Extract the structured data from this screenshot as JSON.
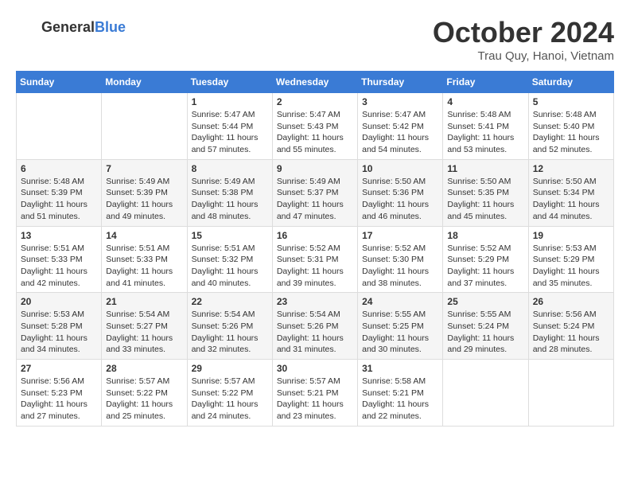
{
  "header": {
    "logo_general": "General",
    "logo_blue": "Blue",
    "month": "October 2024",
    "location": "Trau Quy, Hanoi, Vietnam"
  },
  "weekdays": [
    "Sunday",
    "Monday",
    "Tuesday",
    "Wednesday",
    "Thursday",
    "Friday",
    "Saturday"
  ],
  "weeks": [
    [
      {
        "day": "",
        "info": ""
      },
      {
        "day": "",
        "info": ""
      },
      {
        "day": "1",
        "info": "Sunrise: 5:47 AM\nSunset: 5:44 PM\nDaylight: 11 hours\nand 57 minutes."
      },
      {
        "day": "2",
        "info": "Sunrise: 5:47 AM\nSunset: 5:43 PM\nDaylight: 11 hours\nand 55 minutes."
      },
      {
        "day": "3",
        "info": "Sunrise: 5:47 AM\nSunset: 5:42 PM\nDaylight: 11 hours\nand 54 minutes."
      },
      {
        "day": "4",
        "info": "Sunrise: 5:48 AM\nSunset: 5:41 PM\nDaylight: 11 hours\nand 53 minutes."
      },
      {
        "day": "5",
        "info": "Sunrise: 5:48 AM\nSunset: 5:40 PM\nDaylight: 11 hours\nand 52 minutes."
      }
    ],
    [
      {
        "day": "6",
        "info": "Sunrise: 5:48 AM\nSunset: 5:39 PM\nDaylight: 11 hours\nand 51 minutes."
      },
      {
        "day": "7",
        "info": "Sunrise: 5:49 AM\nSunset: 5:39 PM\nDaylight: 11 hours\nand 49 minutes."
      },
      {
        "day": "8",
        "info": "Sunrise: 5:49 AM\nSunset: 5:38 PM\nDaylight: 11 hours\nand 48 minutes."
      },
      {
        "day": "9",
        "info": "Sunrise: 5:49 AM\nSunset: 5:37 PM\nDaylight: 11 hours\nand 47 minutes."
      },
      {
        "day": "10",
        "info": "Sunrise: 5:50 AM\nSunset: 5:36 PM\nDaylight: 11 hours\nand 46 minutes."
      },
      {
        "day": "11",
        "info": "Sunrise: 5:50 AM\nSunset: 5:35 PM\nDaylight: 11 hours\nand 45 minutes."
      },
      {
        "day": "12",
        "info": "Sunrise: 5:50 AM\nSunset: 5:34 PM\nDaylight: 11 hours\nand 44 minutes."
      }
    ],
    [
      {
        "day": "13",
        "info": "Sunrise: 5:51 AM\nSunset: 5:33 PM\nDaylight: 11 hours\nand 42 minutes."
      },
      {
        "day": "14",
        "info": "Sunrise: 5:51 AM\nSunset: 5:33 PM\nDaylight: 11 hours\nand 41 minutes."
      },
      {
        "day": "15",
        "info": "Sunrise: 5:51 AM\nSunset: 5:32 PM\nDaylight: 11 hours\nand 40 minutes."
      },
      {
        "day": "16",
        "info": "Sunrise: 5:52 AM\nSunset: 5:31 PM\nDaylight: 11 hours\nand 39 minutes."
      },
      {
        "day": "17",
        "info": "Sunrise: 5:52 AM\nSunset: 5:30 PM\nDaylight: 11 hours\nand 38 minutes."
      },
      {
        "day": "18",
        "info": "Sunrise: 5:52 AM\nSunset: 5:29 PM\nDaylight: 11 hours\nand 37 minutes."
      },
      {
        "day": "19",
        "info": "Sunrise: 5:53 AM\nSunset: 5:29 PM\nDaylight: 11 hours\nand 35 minutes."
      }
    ],
    [
      {
        "day": "20",
        "info": "Sunrise: 5:53 AM\nSunset: 5:28 PM\nDaylight: 11 hours\nand 34 minutes."
      },
      {
        "day": "21",
        "info": "Sunrise: 5:54 AM\nSunset: 5:27 PM\nDaylight: 11 hours\nand 33 minutes."
      },
      {
        "day": "22",
        "info": "Sunrise: 5:54 AM\nSunset: 5:26 PM\nDaylight: 11 hours\nand 32 minutes."
      },
      {
        "day": "23",
        "info": "Sunrise: 5:54 AM\nSunset: 5:26 PM\nDaylight: 11 hours\nand 31 minutes."
      },
      {
        "day": "24",
        "info": "Sunrise: 5:55 AM\nSunset: 5:25 PM\nDaylight: 11 hours\nand 30 minutes."
      },
      {
        "day": "25",
        "info": "Sunrise: 5:55 AM\nSunset: 5:24 PM\nDaylight: 11 hours\nand 29 minutes."
      },
      {
        "day": "26",
        "info": "Sunrise: 5:56 AM\nSunset: 5:24 PM\nDaylight: 11 hours\nand 28 minutes."
      }
    ],
    [
      {
        "day": "27",
        "info": "Sunrise: 5:56 AM\nSunset: 5:23 PM\nDaylight: 11 hours\nand 27 minutes."
      },
      {
        "day": "28",
        "info": "Sunrise: 5:57 AM\nSunset: 5:22 PM\nDaylight: 11 hours\nand 25 minutes."
      },
      {
        "day": "29",
        "info": "Sunrise: 5:57 AM\nSunset: 5:22 PM\nDaylight: 11 hours\nand 24 minutes."
      },
      {
        "day": "30",
        "info": "Sunrise: 5:57 AM\nSunset: 5:21 PM\nDaylight: 11 hours\nand 23 minutes."
      },
      {
        "day": "31",
        "info": "Sunrise: 5:58 AM\nSunset: 5:21 PM\nDaylight: 11 hours\nand 22 minutes."
      },
      {
        "day": "",
        "info": ""
      },
      {
        "day": "",
        "info": ""
      }
    ]
  ]
}
